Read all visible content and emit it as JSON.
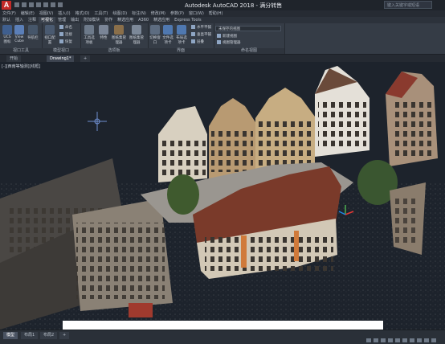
{
  "app": {
    "logo": "A",
    "title": "Autodesk AutoCAD 2018 - 满分转售",
    "search_placeholder": "键入关键字或短语"
  },
  "menu": [
    "文件(F)",
    "编辑(E)",
    "视图(V)",
    "插入(I)",
    "格式(O)",
    "工具(T)",
    "绘图(D)",
    "标注(N)",
    "修改(M)",
    "参数(P)",
    "窗口(W)",
    "帮助(H)"
  ],
  "ribbon_tabs": [
    "默认",
    "插入",
    "注释",
    "可视化",
    "管理",
    "输出",
    "附加模块",
    "协作",
    "精选应用",
    "A360",
    "精选应用",
    "Express Tools"
  ],
  "active_ribbon_tab": "可视化",
  "ribbon": {
    "panels": [
      {
        "label": "视口工具",
        "buttons": [
          "UCS 图标",
          "View Cube",
          "导航栏"
        ]
      },
      {
        "label": "模型视口",
        "buttons": [
          "视口配置",
          "命名",
          "连接",
          "恢复"
        ]
      },
      {
        "label": "选项板",
        "buttons": [
          "工具选项板",
          "特性",
          "图纸集管理器",
          "图纸集管理器"
        ]
      },
      {
        "label": "界面",
        "buttons": [
          "切换窗口",
          "文件选项卡",
          "布局选项卡",
          "水平平铺",
          "垂直平铺",
          "层叠"
        ]
      },
      {
        "label": "命名视图",
        "buttons": [
          "新建视图",
          "视图管理器"
        ]
      }
    ],
    "dropdown_value": "未保存的视图"
  },
  "doc_tabs": [
    "开始",
    "Drawing1*"
  ],
  "active_doc_tab": "Drawing1*",
  "viewport_label": "[-][西南等轴测][线框]",
  "layout_tabs": [
    "模型",
    "布局1",
    "布局2"
  ],
  "active_layout_tab": "模型",
  "colors": {
    "accent": "#c42a28",
    "ribbon_bg": "#353c46",
    "viewport_bg": "#1d232c"
  }
}
